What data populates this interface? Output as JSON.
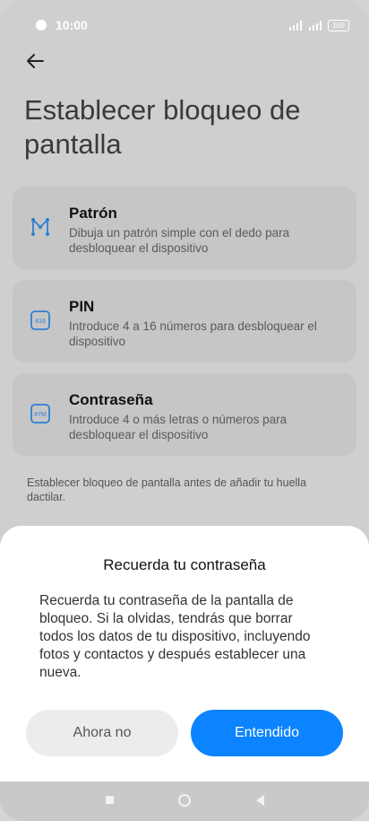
{
  "status_bar": {
    "time": "10:00",
    "battery": "100"
  },
  "page": {
    "title": "Establecer bloqueo de pantalla",
    "options": [
      {
        "title": "Patrón",
        "description": "Dibuja un patrón simple con el dedo para desbloquear el dispositivo",
        "icon": "pattern-icon"
      },
      {
        "title": "PIN",
        "description": "Introduce 4 a 16 números para desbloquear el dispositivo",
        "icon": "pin-icon"
      },
      {
        "title": "Contraseña",
        "description": "Introduce 4 o más letras o números para desbloquear el dispositivo",
        "icon": "password-icon"
      }
    ],
    "note": "Establecer bloqueo de pantalla antes de añadir tu huella dactilar.",
    "icon_texts": {
      "pin": "816",
      "password": "#7M"
    }
  },
  "dialog": {
    "title": "Recuerda tu contraseña",
    "body": "Recuerda tu contraseña de la pantalla de bloqueo. Si la olvidas, tendrás que borrar todos los datos de tu dispositivo, incluyendo fotos y contactos y después establecer una nueva.",
    "secondary_label": "Ahora no",
    "primary_label": "Entendido"
  },
  "colors": {
    "accent": "#0d84ff",
    "icon_blue": "#2d7fd4"
  }
}
